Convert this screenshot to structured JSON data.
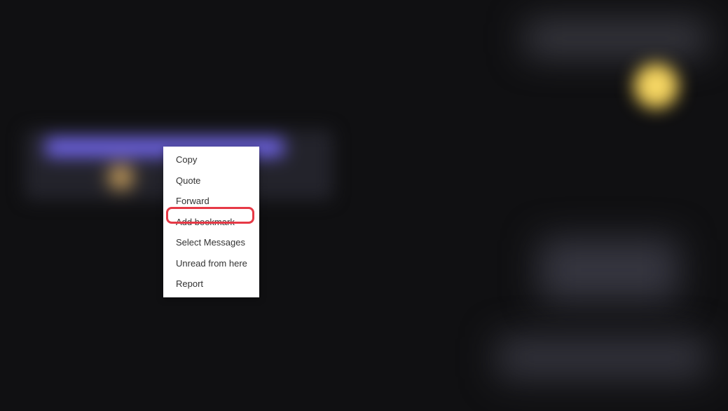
{
  "context_menu": {
    "items": [
      {
        "label": "Copy"
      },
      {
        "label": "Quote"
      },
      {
        "label": "Forward"
      },
      {
        "label": "Add bookmark"
      },
      {
        "label": "Select Messages"
      },
      {
        "label": "Unread from here"
      },
      {
        "label": "Report"
      }
    ],
    "highlighted_index": 3
  },
  "highlight_color": "#e63946"
}
